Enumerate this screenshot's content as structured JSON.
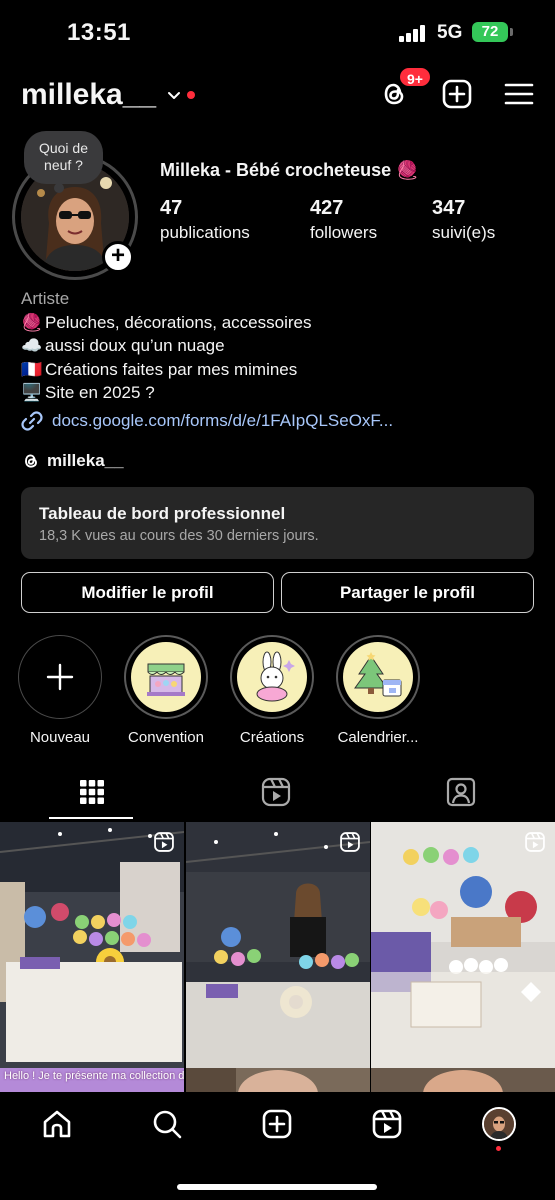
{
  "status_bar": {
    "time": "13:51",
    "network": "5G",
    "battery": "72"
  },
  "header": {
    "username": "milleka__",
    "notification_badge": "9+",
    "icons": [
      "threads-icon",
      "create-icon",
      "menu-icon"
    ]
  },
  "profile": {
    "note": "Quoi de neuf ?",
    "display_name": "Milleka - Bébé crocheteuse 🧶",
    "stats": [
      {
        "value": "47",
        "label": "publications"
      },
      {
        "value": "427",
        "label": "followers"
      },
      {
        "value": "347",
        "label": "suivi(e)s"
      }
    ],
    "category": "Artiste",
    "bio_lines": [
      {
        "emoji": "🧶",
        "text": "Peluches, décorations, accessoires"
      },
      {
        "emoji": "☁️",
        "text": "aussi doux qu’un nuage"
      },
      {
        "emoji": "🇫🇷",
        "text": "Créations faites par mes mimines"
      },
      {
        "emoji": "🖥️",
        "text": "Site en 2025 ?"
      }
    ],
    "link": "docs.google.com/forms/d/e/1FAIpQLSeOxF...",
    "threads_handle": "milleka__"
  },
  "dashboard": {
    "title": "Tableau de bord professionnel",
    "subtitle": "18,3 K vues au cours des 30 derniers jours."
  },
  "buttons": {
    "edit_profile": "Modifier le profil",
    "share_profile": "Partager le profil"
  },
  "highlights": [
    {
      "label": "Nouveau",
      "icon": "plus-icon"
    },
    {
      "label": "Convention",
      "icon": "market-stall-icon"
    },
    {
      "label": "Créations",
      "icon": "bunny-plush-icon"
    },
    {
      "label": "Calendrier...",
      "icon": "christmas-tree-calendar-icon"
    }
  ],
  "tabs": [
    {
      "name": "grid",
      "icon": "grid-icon",
      "active": true
    },
    {
      "name": "reels",
      "icon": "reels-icon",
      "active": false
    },
    {
      "name": "tagged",
      "icon": "tagged-icon",
      "active": false
    }
  ],
  "posts": [
    {
      "type": "reel"
    },
    {
      "type": "reel"
    },
    {
      "type": "reel"
    }
  ],
  "post_row2_caption": "Hello ! Je te présente ma collection de Junimos pour",
  "bottom_nav": [
    "home-icon",
    "search-icon",
    "create-icon",
    "reels-icon",
    "profile-avatar"
  ],
  "colors": {
    "background": "#000000",
    "accent_red": "#ff2d3c",
    "link_blue": "#a8c7fa",
    "battery_green": "#34c759",
    "card_bg": "#262626"
  }
}
